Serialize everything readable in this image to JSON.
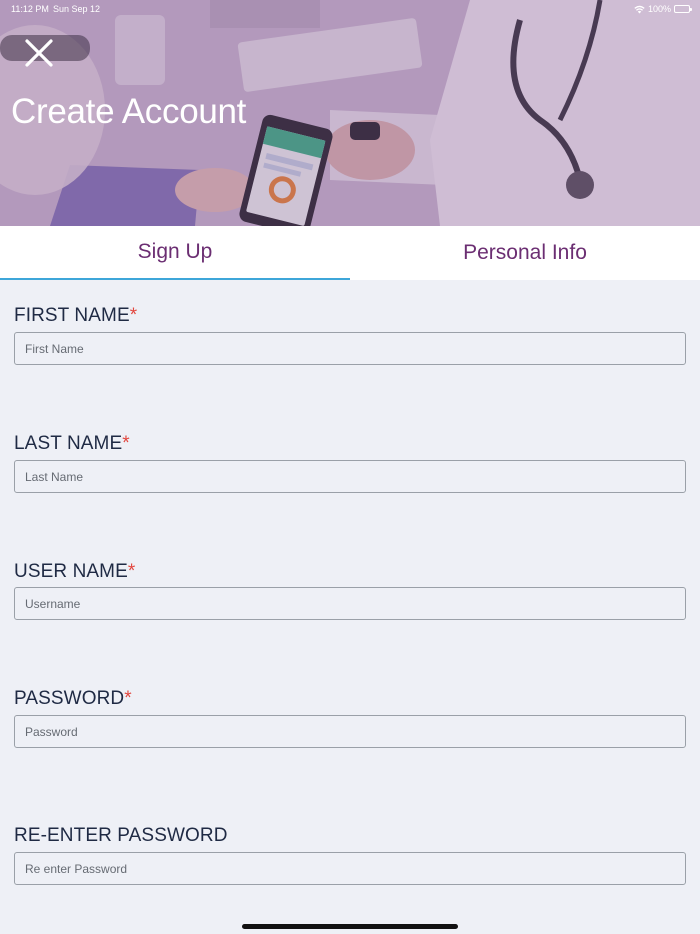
{
  "status_bar": {
    "time": "11:12 PM",
    "date": "Sun Sep 12",
    "battery": "100%",
    "wifi_icon": "wifi-icon",
    "battery_icon": "battery-icon"
  },
  "header": {
    "title": "Create Account",
    "close_icon": "close-icon"
  },
  "tabs": [
    {
      "label": "Sign Up",
      "active": true
    },
    {
      "label": "Personal Info",
      "active": false
    }
  ],
  "form": {
    "required_marker": "*",
    "fields": [
      {
        "label": "FIRST NAME",
        "required": true,
        "placeholder": "First Name",
        "value": ""
      },
      {
        "label": "LAST NAME",
        "required": true,
        "placeholder": "Last Name",
        "value": ""
      },
      {
        "label": "USER NAME",
        "required": true,
        "placeholder": "Username",
        "value": ""
      },
      {
        "label": "PASSWORD",
        "required": true,
        "placeholder": "Password",
        "value": ""
      },
      {
        "label": "RE-ENTER PASSWORD",
        "required": false,
        "placeholder": "Re enter Password",
        "value": ""
      }
    ]
  },
  "colors": {
    "accent_purple": "#6b2e72",
    "tab_underline": "#3da6d9",
    "required_red": "#e2473f",
    "label_text": "#1f2a44",
    "background": "#eef0f6"
  }
}
